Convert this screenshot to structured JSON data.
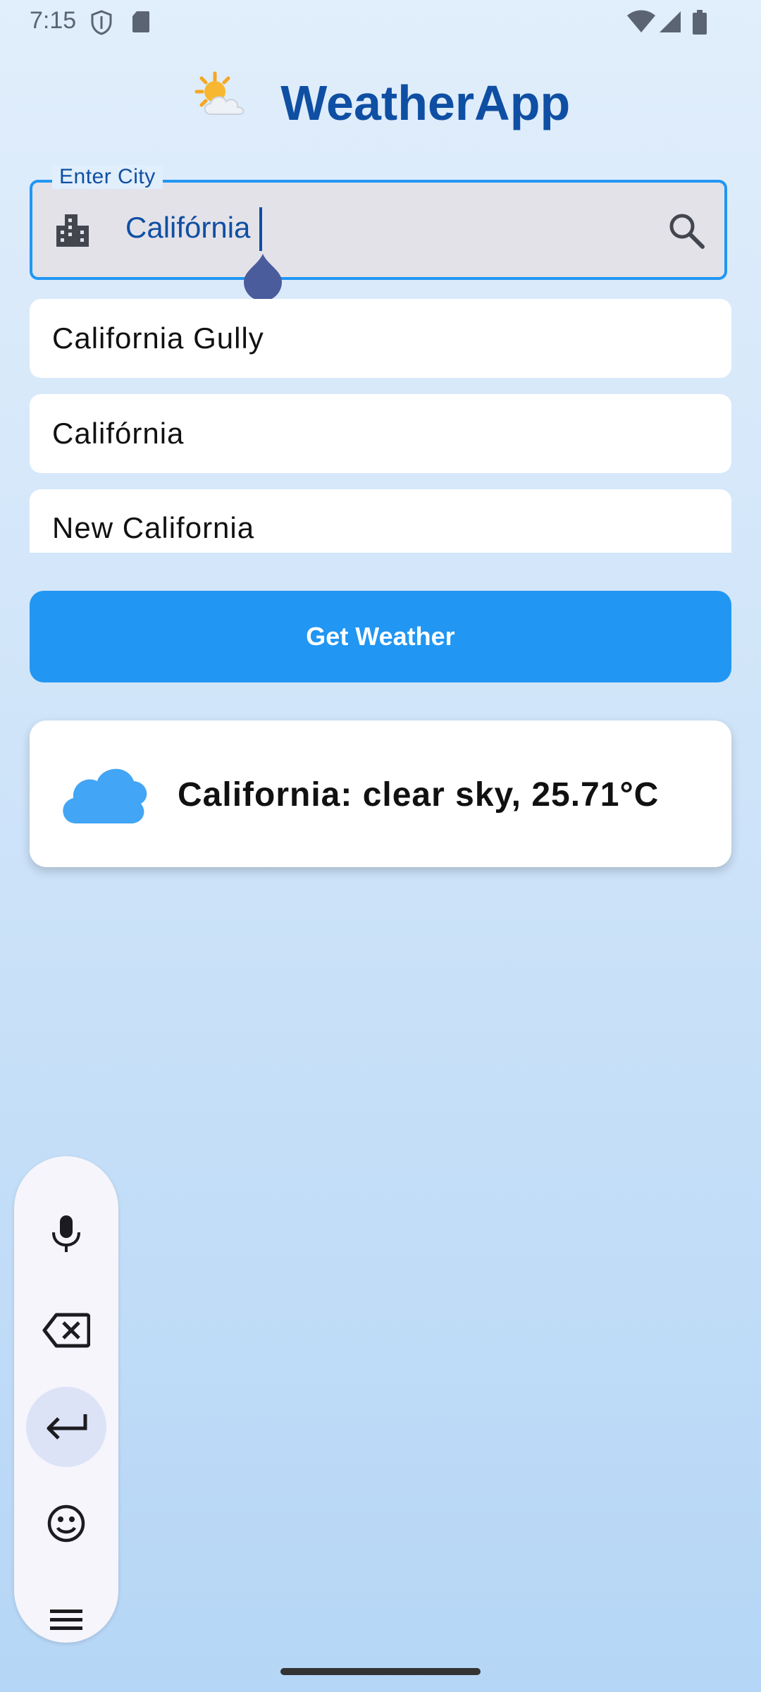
{
  "status_bar": {
    "time": "7:15",
    "icons": [
      "shield-icon",
      "sd-card-icon",
      "wifi-icon",
      "signal-icon",
      "battery-icon"
    ]
  },
  "header": {
    "title": "WeatherApp",
    "icon": "sun-behind-cloud-emoji"
  },
  "search": {
    "label": "Enter City",
    "value": "Califórnia",
    "leading_icon": "city-icon",
    "trailing_icon": "search-icon"
  },
  "suggestions": [
    {
      "label": "California Gully"
    },
    {
      "label": "Califórnia"
    },
    {
      "label": "New California"
    }
  ],
  "button": {
    "label": "Get Weather"
  },
  "result": {
    "text": "California: clear sky, 25.71°C",
    "icon": "cloud-icon"
  },
  "keyboard_toolbar": {
    "items": [
      "mic-icon",
      "backspace-icon",
      "enter-icon",
      "emoji-icon",
      "menu-icon"
    ]
  },
  "colors": {
    "accent": "#2196f3",
    "title": "#0f4fa3",
    "cloud": "#42a5f5"
  }
}
